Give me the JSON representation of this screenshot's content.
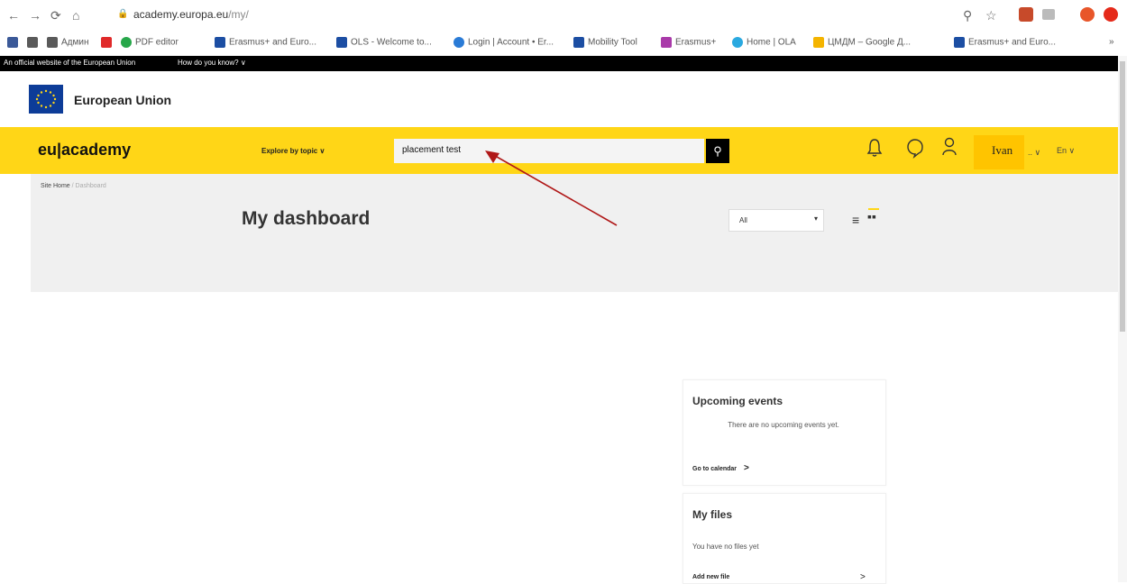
{
  "browser": {
    "url_host": "academy.europa.eu",
    "url_path": "/my/",
    "bookmarks": [
      {
        "label": "Админ",
        "color": "#5a5a5a"
      },
      {
        "label": "PDF editor",
        "color": "#27a74a"
      },
      {
        "label": "Erasmus+ and Euro...",
        "color": "#1c4ea3"
      },
      {
        "label": "OLS - Welcome to...",
        "color": "#1c4ea3"
      },
      {
        "label": "Login | Account • Er...",
        "color": "#2a7bd6"
      },
      {
        "label": "Mobility Tool",
        "color": "#1c4ea3"
      },
      {
        "label": "Erasmus+",
        "color": "#a93aa9"
      },
      {
        "label": "Home | OLA",
        "color": "#2aa9e0"
      },
      {
        "label": "ЦМДМ – Google Д...",
        "color": "#f4b400"
      },
      {
        "label": "Erasmus+ and Euro...",
        "color": "#1c4ea3"
      }
    ]
  },
  "eu_bar": {
    "official": "An official website of the European Union",
    "how": "How do you know? ∨"
  },
  "eu_header": {
    "title": "European Union"
  },
  "nav": {
    "logo": "eu|academy",
    "explore": "Explore by topic ∨",
    "search_value": "placement test",
    "username": "Ivan",
    "user_extra": ".. ∨",
    "lang": "En ∨"
  },
  "breadcrumb": {
    "home": "Site Home",
    "sep": "/",
    "current": "Dashboard"
  },
  "dashboard": {
    "title": "My dashboard",
    "filter_value": "All"
  },
  "upcoming": {
    "title": "Upcoming events",
    "empty": "There are no upcoming events yet.",
    "link": "Go to calendar"
  },
  "files": {
    "title": "My files",
    "empty": "You have no files yet",
    "link": "Add new file"
  },
  "colors": {
    "brand_yellow": "#ffd617",
    "annotation_arrow": "#b01818"
  }
}
